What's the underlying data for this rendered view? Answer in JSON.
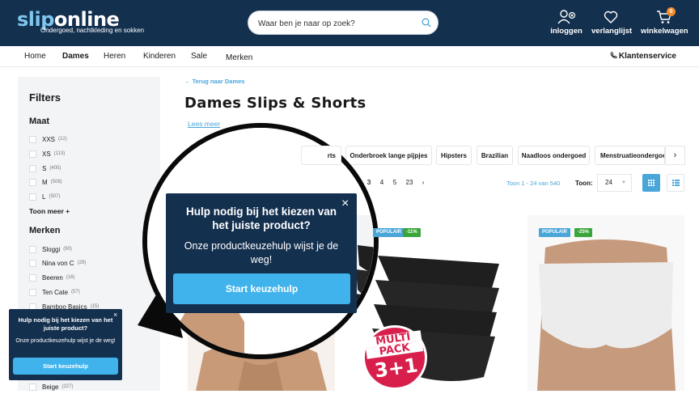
{
  "header": {
    "logo_part1": "slip",
    "logo_part2": "online",
    "tagline": "Ondergoed, nachtkleding en sokken",
    "search_placeholder": "Waar ben je naar op zoek?",
    "login_label": "inloggen",
    "wishlist_label": "verlanglijst",
    "cart_label": "winkelwagen",
    "cart_count": "0"
  },
  "nav": {
    "items": [
      "Home",
      "Dames",
      "Heren",
      "Kinderen",
      "Sale",
      "Merken"
    ],
    "service": "Klantenservice"
  },
  "sidebar": {
    "title": "Filters",
    "size_heading": "Maat",
    "sizes": [
      {
        "label": "XXS",
        "count": "(12)"
      },
      {
        "label": "XS",
        "count": "(113)"
      },
      {
        "label": "S",
        "count": "(405)"
      },
      {
        "label": "M",
        "count": "(508)"
      },
      {
        "label": "L",
        "count": "(507)"
      }
    ],
    "more_label": "Toon meer +",
    "brand_heading": "Merken",
    "brands": [
      {
        "label": "Sloggi",
        "count": "(90)"
      },
      {
        "label": "Nina von C",
        "count": "(29)"
      },
      {
        "label": "Beeren",
        "count": "(16)"
      },
      {
        "label": "Ten Cate",
        "count": "(57)"
      },
      {
        "label": "Bamboo Basics",
        "count": "(15)"
      }
    ],
    "color_last": {
      "label": "Beige",
      "count": "(227)"
    }
  },
  "main": {
    "back_link": "Terug naar Dames",
    "title": "Dames Slips & Shorts",
    "read_more": "Lees meer",
    "chips": [
      "rts",
      "Onderbroek lange pijpjes",
      "Hipsters",
      "Brazilian",
      "Naadloos ondergoed",
      "Menstruatieondergoed"
    ],
    "pages": [
      "3",
      "4",
      "5",
      "23",
      "›"
    ],
    "showing": "Toon 1 - 24 van 540",
    "show_label": "Toon:",
    "show_value": "24"
  },
  "products": [
    {
      "badge": "POPULAIR",
      "discount": "-11%",
      "sticker_line1": "MULTI",
      "sticker_line2": "PACK",
      "sticker_line3": "3+1"
    },
    {
      "badge": "POPULAIR",
      "discount": "-25%"
    }
  ],
  "popup": {
    "title": "Hulp nodig bij het kiezen van het juiste product?",
    "text": "Onze productkeuzehulp wijst je de weg!",
    "button": "Start keuzehulp",
    "close": "×"
  },
  "colors": {
    "navy": "#14304f",
    "accent": "#40b3ec",
    "link": "#4aa6d9",
    "populair": "#4aa6d9",
    "discount": "#3aa53a",
    "cart_badge": "#f28c28"
  }
}
